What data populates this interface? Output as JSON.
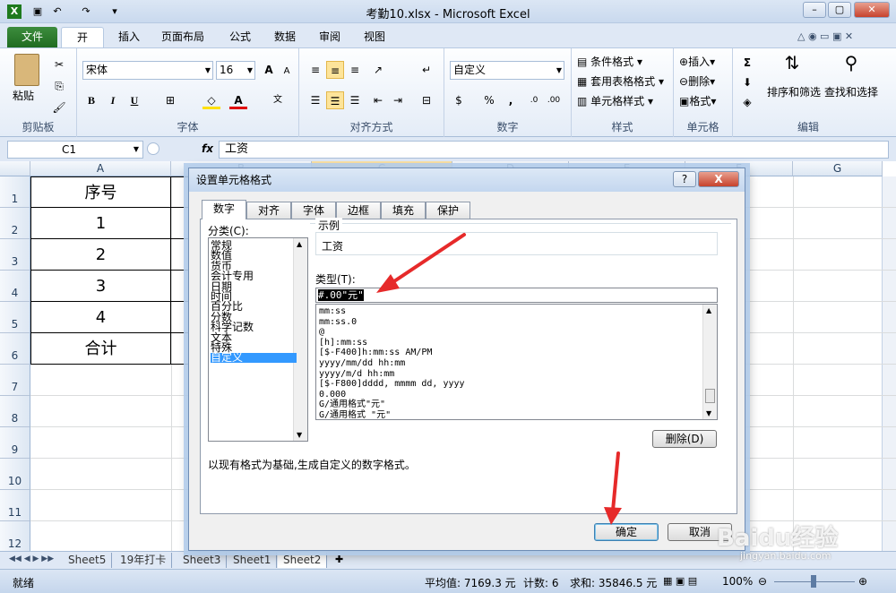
{
  "app": {
    "title": "考勤10.xlsx - Microsoft Excel"
  },
  "tabs": [
    "文件",
    "开始",
    "插入",
    "页面布局",
    "公式",
    "数据",
    "审阅",
    "视图"
  ],
  "ribbon": {
    "clipboard": {
      "paste": "粘贴",
      "label": "剪贴板"
    },
    "font": {
      "name": "宋体",
      "size": "16",
      "label": "字体",
      "bold": "B",
      "italic": "I",
      "underline": "U"
    },
    "alignment": {
      "label": "对齐方式"
    },
    "number": {
      "format": "自定义",
      "label": "数字",
      "percent": "%",
      "comma": ","
    },
    "styles": {
      "conditional": "条件格式",
      "table": "套用表格格式",
      "cell": "单元格样式",
      "label": "样式"
    },
    "cells": {
      "insert": "插入",
      "delete": "删除",
      "format": "格式",
      "label": "单元格"
    },
    "editing": {
      "sort": "排序和筛选",
      "find": "查找和选择",
      "label": "编辑",
      "sum": "Σ"
    }
  },
  "formula_bar": {
    "name_box": "C1",
    "fx": "fx",
    "content": "工资"
  },
  "grid": {
    "columns": [
      "A",
      "B",
      "C",
      "D",
      "E",
      "F",
      "G"
    ],
    "rows": [
      "1",
      "2",
      "3",
      "4",
      "5",
      "6",
      "7",
      "8",
      "9",
      "10",
      "11",
      "12"
    ],
    "column_a": [
      "序号",
      "1",
      "2",
      "3",
      "4",
      "合计"
    ]
  },
  "sheets": [
    "Sheet5",
    "19年打卡",
    "Sheet3",
    "Sheet1",
    "Sheet2"
  ],
  "status": {
    "ready": "就绪",
    "average": "平均值: 7169.3 元",
    "count": "计数: 6",
    "sum": "求和: 35846.5 元",
    "zoom": "100%"
  },
  "dialog": {
    "title": "设置单元格格式",
    "help": "?",
    "close": "X",
    "tabs": [
      "数字",
      "对齐",
      "字体",
      "边框",
      "填充",
      "保护"
    ],
    "category_label": "分类(C):",
    "categories": [
      "常规",
      "数值",
      "货币",
      "会计专用",
      "日期",
      "时间",
      "百分比",
      "分数",
      "科学记数",
      "文本",
      "特殊",
      "自定义"
    ],
    "sample_label": "示例",
    "sample_value": "工资",
    "type_label": "类型(T):",
    "type_value": "#.00\"元\"",
    "formats": [
      "mm:ss",
      "mm:ss.0",
      "@",
      "[h]:mm:ss",
      "[$-F400]h:mm:ss AM/PM",
      "yyyy/mm/dd hh:mm",
      "yyyy/m/d  hh:mm",
      "[$-F800]dddd, mmmm dd, yyyy",
      "0.000",
      "G/通用格式\"元\"",
      "G/通用格式 \"元\""
    ],
    "delete_button": "删除(D)",
    "description": "以现有格式为基础,生成自定义的数字格式。",
    "ok": "确定",
    "cancel": "取消"
  },
  "watermark": {
    "text": "Baidu经验",
    "sub": "jingyan.baidu.com"
  },
  "colors": {
    "accent": "#e62a2a",
    "file_tab": "#2a7a2c",
    "selection": "#3399ff"
  }
}
